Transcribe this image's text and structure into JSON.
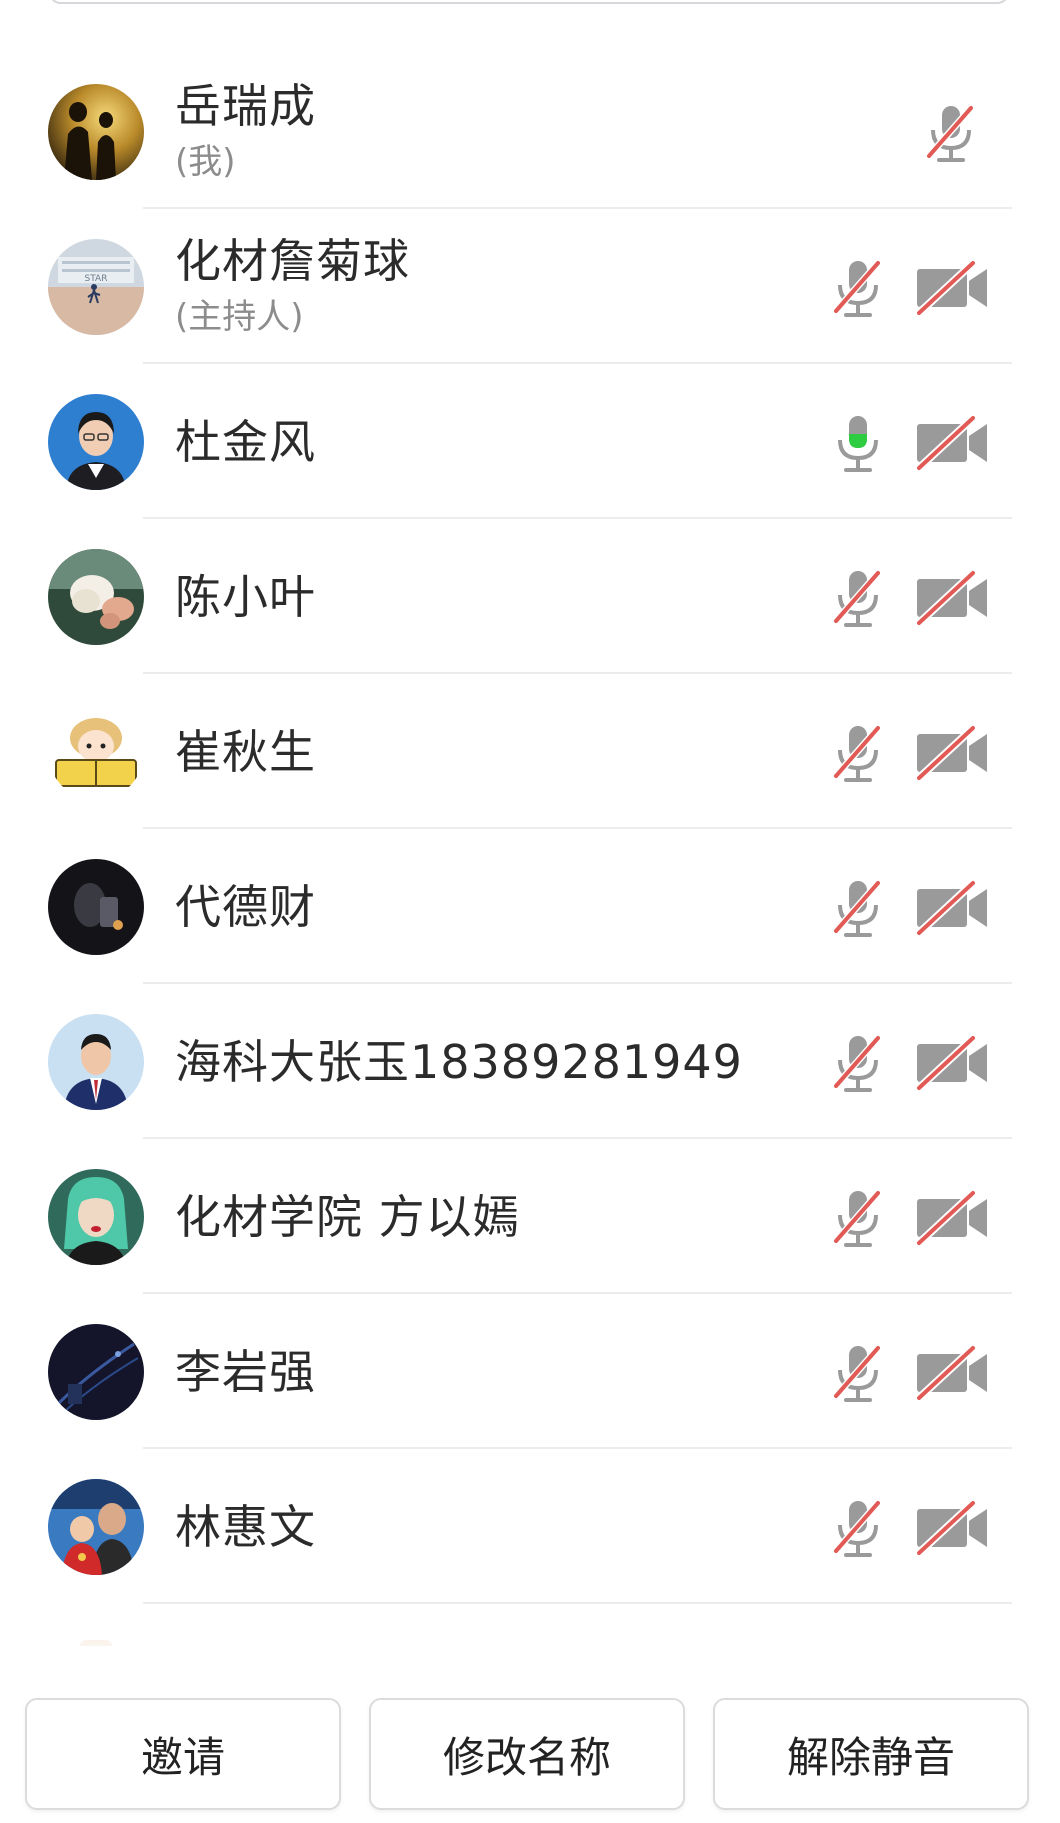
{
  "participants": [
    {
      "name": "岳瑞成",
      "role": "(我)",
      "mic": "muted",
      "camera": "none",
      "avatar": "avatar-couple-sunset"
    },
    {
      "name": "化材詹菊球",
      "role": "(主持人)",
      "mic": "muted",
      "camera": "off",
      "avatar": "avatar-building-plaza"
    },
    {
      "name": "杜金风",
      "role": "",
      "mic": "active",
      "camera": "off",
      "avatar": "avatar-woman-portrait"
    },
    {
      "name": "陈小叶",
      "role": "",
      "mic": "muted",
      "camera": "off",
      "avatar": "avatar-flower"
    },
    {
      "name": "崔秋生",
      "role": "",
      "mic": "muted",
      "camera": "off",
      "avatar": "avatar-cartoon-reader"
    },
    {
      "name": "代德财",
      "role": "",
      "mic": "muted",
      "camera": "off",
      "avatar": "avatar-dark-figure"
    },
    {
      "name": "海科大张玉18389281949",
      "role": "",
      "mic": "muted",
      "camera": "off",
      "avatar": "avatar-man-suit"
    },
    {
      "name": "化材学院 方以嫣",
      "role": "",
      "mic": "muted",
      "camera": "off",
      "avatar": "avatar-green-hair"
    },
    {
      "name": "李岩强",
      "role": "",
      "mic": "muted",
      "camera": "off",
      "avatar": "avatar-night-scene"
    },
    {
      "name": "林惠文",
      "role": "",
      "mic": "muted",
      "camera": "off",
      "avatar": "avatar-family-photo"
    }
  ],
  "buttons": {
    "invite": "邀请",
    "rename": "修改名称",
    "unmute": "解除静音"
  },
  "colors": {
    "muted_slash": "#e25a55",
    "icon_gray": "#9a9a9a",
    "active_green": "#2ecc40"
  },
  "icons": {
    "mic": "microphone-icon",
    "mic_muted": "microphone-muted-icon",
    "camera_off": "camera-off-icon"
  }
}
